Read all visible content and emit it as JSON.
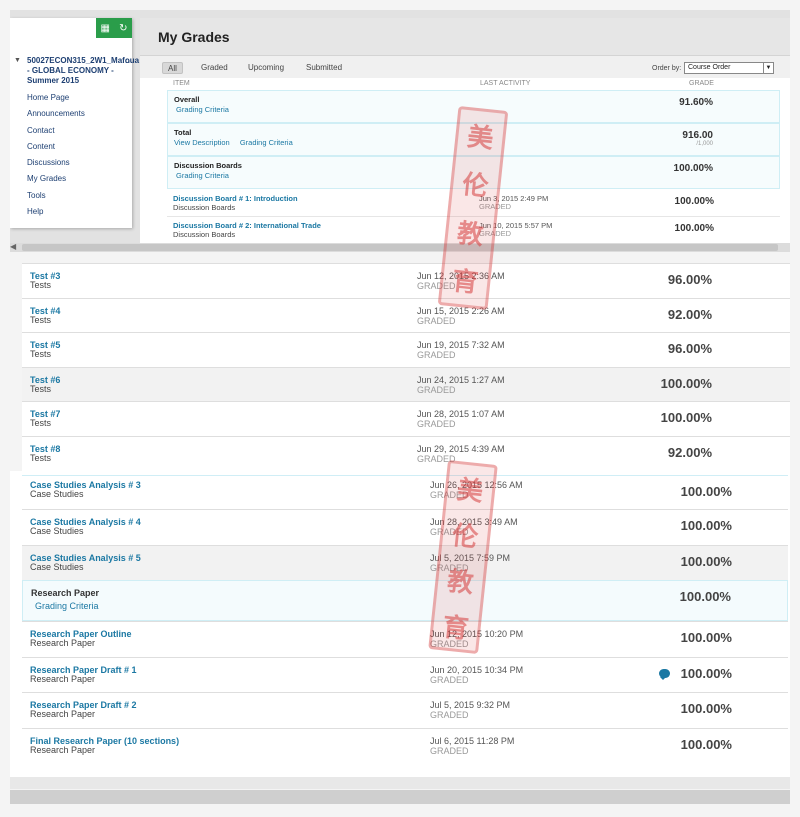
{
  "sidebar": {
    "course_title": "50027ECON315_2W1_Mafoua - GLOBAL ECONOMY - Summer 2015",
    "menu": [
      "Home Page",
      "Announcements",
      "Contact",
      "Content",
      "Discussions",
      "My Grades",
      "Tools",
      "Help"
    ],
    "tool_icons": [
      "edit-mode-icon",
      "refresh-icon"
    ]
  },
  "header": {
    "title": "My Grades"
  },
  "filters": {
    "tabs": [
      "All",
      "Graded",
      "Upcoming",
      "Submitted"
    ],
    "active": "All",
    "order_label": "Order by:",
    "order_value": "Course Order"
  },
  "columns": {
    "item": "ITEM",
    "last_activity": "LAST ACTIVITY",
    "grade": "GRADE"
  },
  "top_rows": [
    {
      "name": "Overall",
      "links": [
        "Grading Criteria"
      ],
      "grade": "91.60%"
    },
    {
      "name": "Total",
      "links": [
        "View Description",
        "Grading Criteria"
      ],
      "grade": "916.00",
      "points": "/1,000"
    },
    {
      "name": "Discussion Boards",
      "links": [
        "Grading Criteria"
      ],
      "grade": "100.00%"
    },
    {
      "name": "Discussion Board # 1: Introduction",
      "category": "Discussion Boards",
      "date": "Jun 3, 2015 2:49 PM",
      "status": "GRADED",
      "grade": "100.00%"
    },
    {
      "name": "Discussion Board # 2: International Trade",
      "category": "Discussion Boards",
      "date": "Jun 10, 2015 5:57 PM",
      "status": "GRADED",
      "grade": "100.00%"
    }
  ],
  "middle_rows": [
    {
      "name": "Test #3",
      "category": "Tests",
      "date": "Jun 12, 2015 2:36 AM",
      "status": "GRADED",
      "grade": "96.00%"
    },
    {
      "name": "Test #4",
      "category": "Tests",
      "date": "Jun 15, 2015 2:26 AM",
      "status": "GRADED",
      "grade": "92.00%"
    },
    {
      "name": "Test #5",
      "category": "Tests",
      "date": "Jun 19, 2015 7:32 AM",
      "status": "GRADED",
      "grade": "96.00%"
    },
    {
      "name": "Test #6",
      "category": "Tests",
      "date": "Jun 24, 2015 1:27 AM",
      "status": "GRADED",
      "grade": "100.00%"
    },
    {
      "name": "Test #7",
      "category": "Tests",
      "date": "Jun 28, 2015 1:07 AM",
      "status": "GRADED",
      "grade": "100.00%"
    },
    {
      "name": "Test #8",
      "category": "Tests",
      "date": "Jun 29, 2015 4:39 AM",
      "status": "GRADED",
      "grade": "92.00%"
    }
  ],
  "bottom_rows": [
    {
      "name": "Case Studies Analysis # 3",
      "category": "Case Studies",
      "date": "Jun 26, 2015 12:56 AM",
      "status": "GRADED",
      "grade": "100.00%"
    },
    {
      "name": "Case Studies Analysis # 4",
      "category": "Case Studies",
      "date": "Jun 28, 2015 3:49 AM",
      "status": "GRADED",
      "grade": "100.00%"
    },
    {
      "name": "Case Studies Analysis # 5",
      "category": "Case Studies",
      "date": "Jul 5, 2015 7:59 PM",
      "status": "GRADED",
      "grade": "100.00%"
    },
    {
      "name": "Research Paper",
      "links": [
        "Grading Criteria"
      ],
      "grade": "100.00%"
    },
    {
      "name": "Research Paper Outline",
      "category": "Research Paper",
      "date": "Jun 12, 2015 10:20 PM",
      "status": "GRADED",
      "grade": "100.00%"
    },
    {
      "name": "Research Paper Draft # 1",
      "category": "Research Paper",
      "date": "Jun 20, 2015 10:34 PM",
      "status": "GRADED",
      "grade": "100.00%",
      "comment_icon": "comment-bubble-icon"
    },
    {
      "name": "Research Paper Draft # 2",
      "category": "Research Paper",
      "date": "Jul 5, 2015 9:32 PM",
      "status": "GRADED",
      "grade": "100.00%"
    },
    {
      "name": "Final Research Paper (10 sections)",
      "category": "Research Paper",
      "date": "Jul 6, 2015 11:28 PM",
      "status": "GRADED",
      "grade": "100.00%"
    }
  ],
  "watermark": "美伦教育",
  "colors": {
    "link": "#1b78a3",
    "tool_green": "#2a9d4a",
    "seal_red": "#d63c3c"
  }
}
